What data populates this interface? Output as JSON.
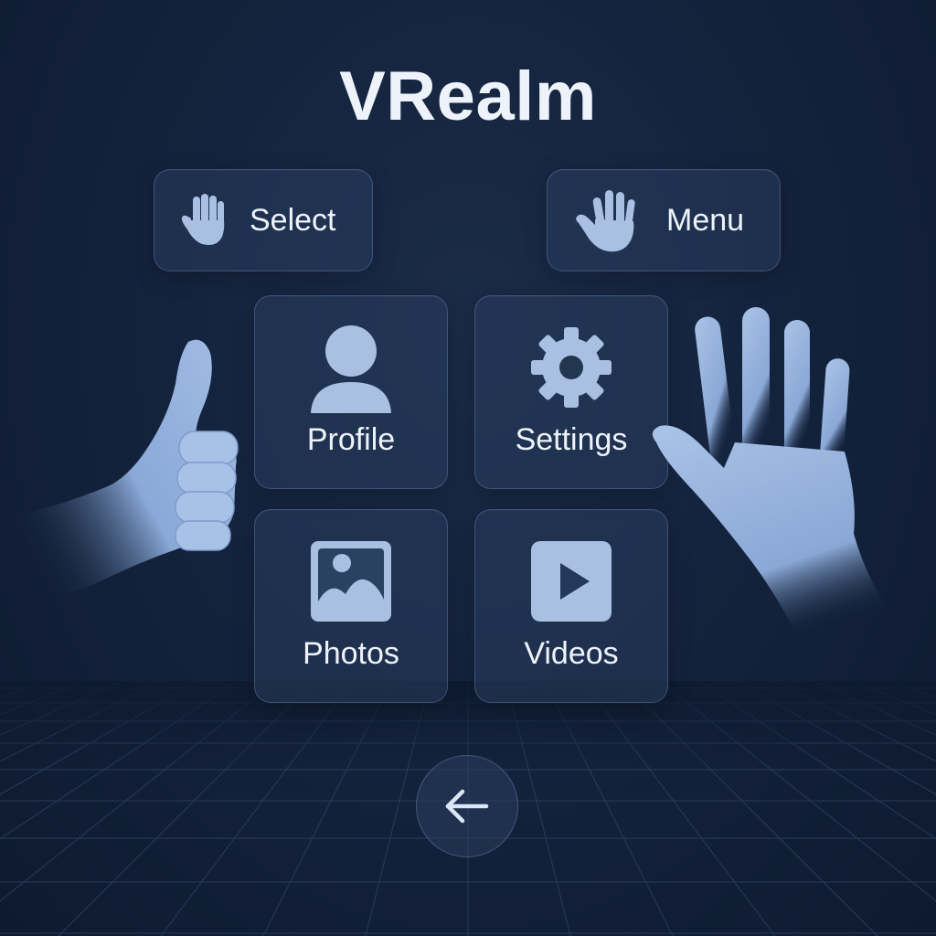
{
  "app": {
    "title": "VRealm"
  },
  "gestures": [
    {
      "label": "Select",
      "icon": "hand-select-icon"
    },
    {
      "label": "Menu",
      "icon": "open-hand-icon"
    }
  ],
  "menu": {
    "tiles": [
      {
        "label": "Profile",
        "icon": "user-icon"
      },
      {
        "label": "Settings",
        "icon": "gear-icon"
      },
      {
        "label": "Photos",
        "icon": "image-icon"
      },
      {
        "label": "Videos",
        "icon": "play-icon"
      }
    ]
  },
  "nav": {
    "back_icon": "arrow-left-icon"
  },
  "colors": {
    "background": "#14233d",
    "panel": "#28405c",
    "icon": "#a9c0e3",
    "text": "#eef3fb",
    "hand": "#9fbae2"
  }
}
